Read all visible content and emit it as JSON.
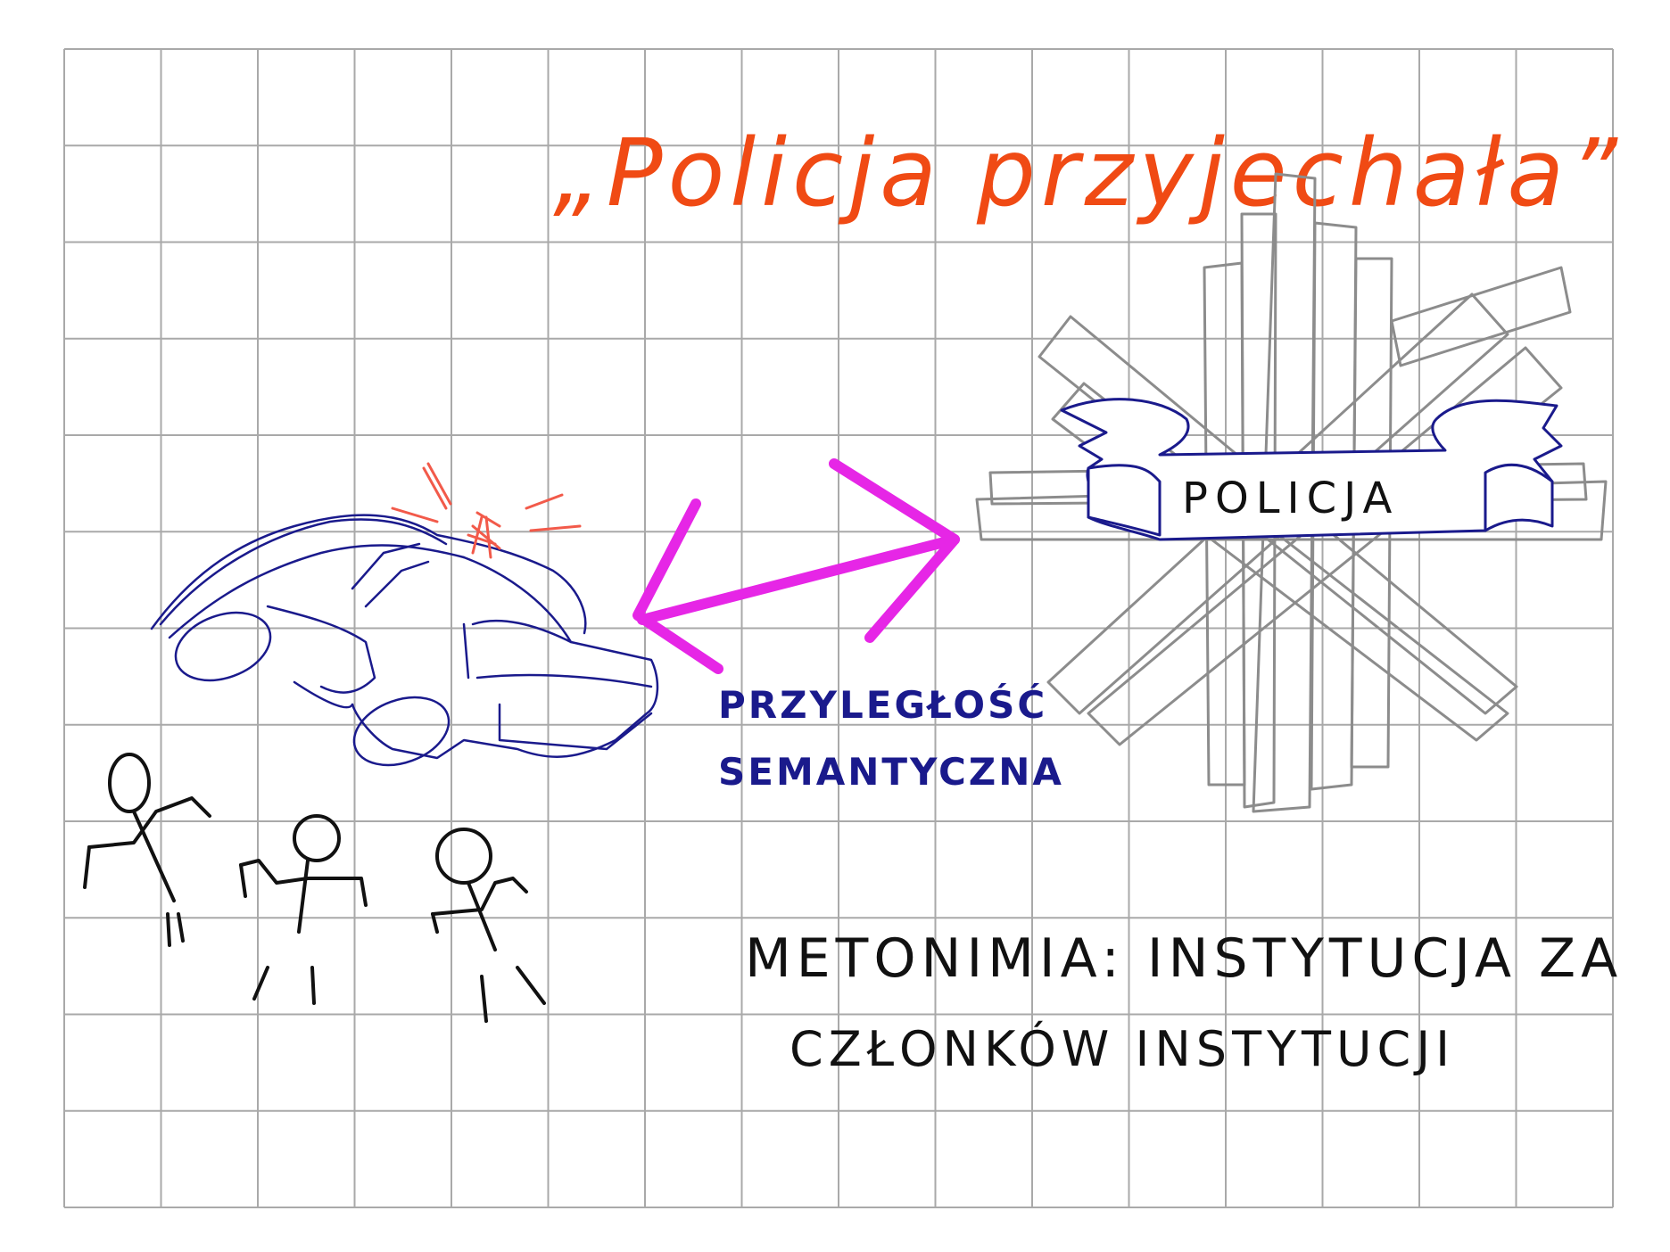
{
  "title": "„Policja przyjechała”",
  "badge": {
    "text": "POLICJA"
  },
  "relation": {
    "line1": "PRZYLEGŁOŚĆ",
    "line2": "SEMANTYCZNA"
  },
  "definition": {
    "line1": "METONIMIA: INSTYTUCJA ZA",
    "line2": "CZŁONKÓW INSTYTUCJI"
  },
  "colors": {
    "grid": "#a9a9a9",
    "title": "#f04a14",
    "car": "#1a1a8c",
    "siren": "#f25a4a",
    "arrow": "#e626e6",
    "star": "#8c8c8c",
    "ink": "#111111"
  },
  "icons": {
    "car": "police-car-drawing",
    "star": "police-star-badge",
    "people": "stick-figures",
    "arrow": "double-headed-arrow"
  }
}
